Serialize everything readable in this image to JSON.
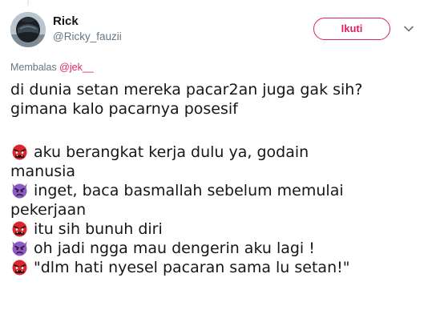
{
  "author": {
    "display_name": "Rick",
    "handle": "@Ricky_fauzii",
    "avatar": "avatar-helmet-photo"
  },
  "header": {
    "follow_label": "Ikuti",
    "menu_icon": "chevron-down-icon"
  },
  "reply_context": {
    "prefix": "Membalas",
    "mention": "@jek__"
  },
  "tweet": {
    "intro_lines": [
      "di dunia setan mereka pacar2an juga gak sih?",
      "gimana kalo pacarnya posesif"
    ],
    "dialogue": [
      {
        "icon": "ogre-emoji-icon",
        "lines": [
          "aku berangkat kerja dulu ya, godain",
          "manusia"
        ]
      },
      {
        "icon": "angry-devil-emoji-icon",
        "lines": [
          "inget, baca basmallah sebelum memulai",
          "pekerjaan"
        ]
      },
      {
        "icon": "ogre-emoji-icon",
        "lines": [
          "itu sih bunuh diri"
        ]
      },
      {
        "icon": "angry-devil-emoji-icon",
        "lines": [
          "oh jadi ngga mau dengerin aku lagi !"
        ]
      },
      {
        "icon": "ogre-emoji-icon",
        "lines": [
          "\"dlm hati nyesel pacaran sama lu setan!\""
        ]
      }
    ]
  },
  "colors": {
    "accent": "#e0245e",
    "text": "#14171a",
    "secondary_text": "#657786",
    "ogre_red": "#d6292f",
    "devil_purple": "#8e5bc1"
  }
}
